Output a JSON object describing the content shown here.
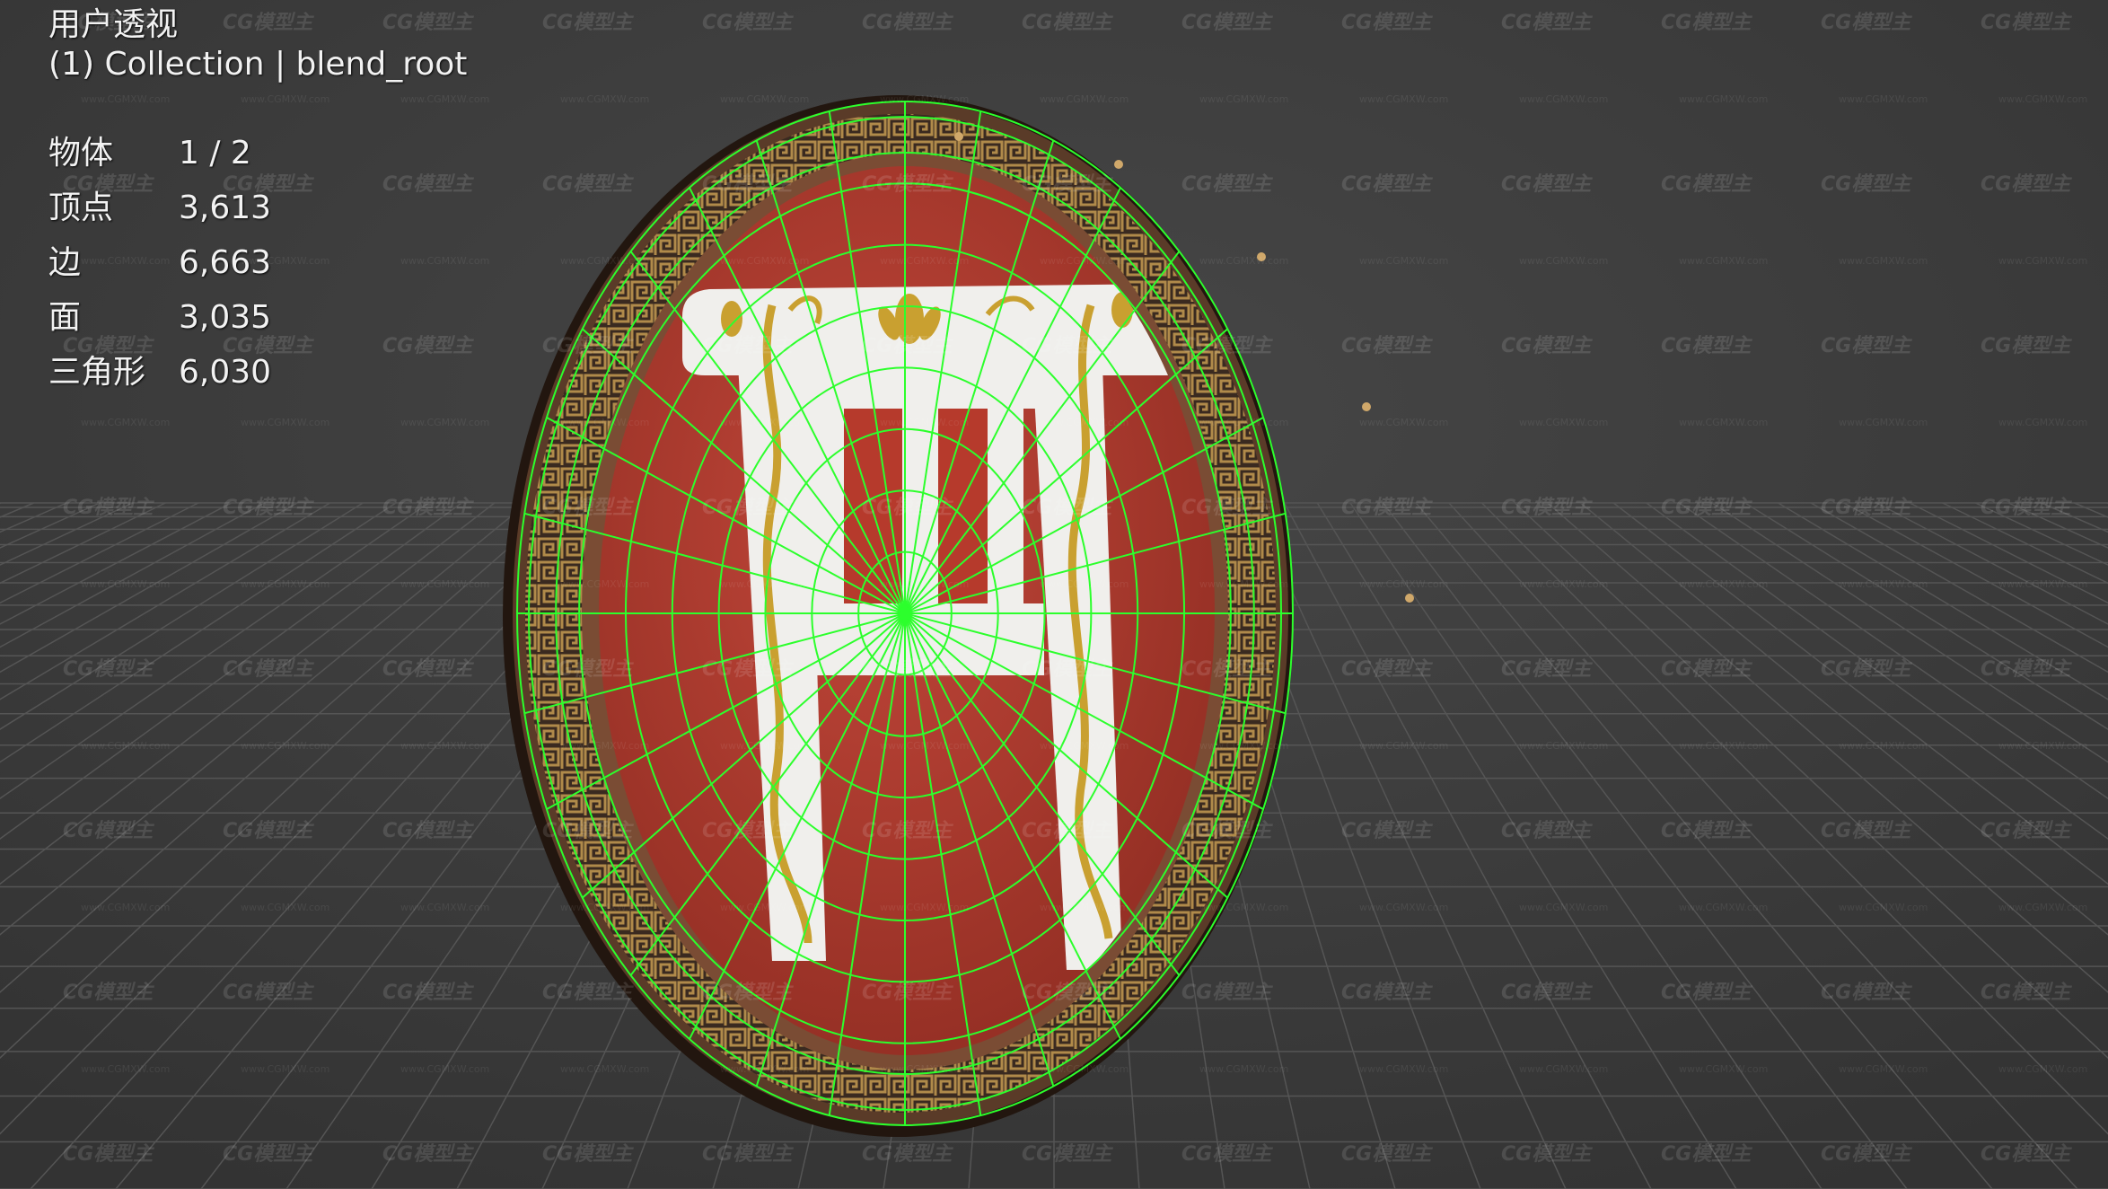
{
  "viewport": {
    "view_name": "用户透视",
    "collection_line": "(1) Collection | blend_root",
    "stats": [
      {
        "label": "物体",
        "value": "1 / 2"
      },
      {
        "label": "顶点",
        "value": "3,613"
      },
      {
        "label": "边",
        "value": "6,663"
      },
      {
        "label": "面",
        "value": "3,035"
      },
      {
        "label": "三角形",
        "value": "6,030"
      }
    ]
  },
  "watermark": {
    "text": "CG模型主",
    "small_text": "www.CGMXW.com"
  },
  "colors": {
    "background": "#3d3d3d",
    "grid": "#5a5a5a",
    "wire": "#2cff2c",
    "shield_face": "#b83a2e",
    "rim_bronze": "#6e4a34",
    "emblem": "#f0efec",
    "gold": "#c9a030"
  },
  "icons": [
    "shield-model",
    "chair-emblem"
  ]
}
